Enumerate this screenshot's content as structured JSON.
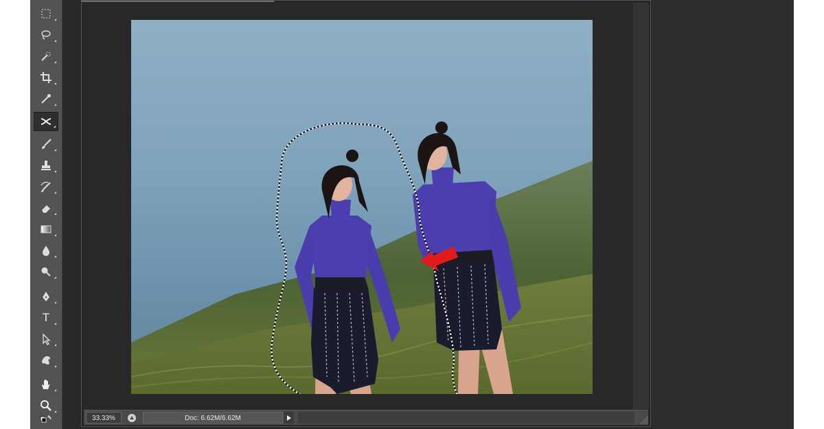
{
  "toolbar": {
    "active_tool": "patch-tool",
    "tools": [
      {
        "name": "marquee-tool-icon"
      },
      {
        "name": "lasso-tool-icon"
      },
      {
        "name": "quick-selection-tool-icon"
      },
      {
        "name": "crop-tool-icon"
      },
      {
        "name": "eyedropper-tool-icon"
      },
      {
        "name": "patch-tool-icon"
      },
      {
        "name": "brush-tool-icon"
      },
      {
        "name": "clone-stamp-tool-icon"
      },
      {
        "name": "history-brush-tool-icon"
      },
      {
        "name": "eraser-tool-icon"
      },
      {
        "name": "gradient-tool-icon"
      },
      {
        "name": "blur-tool-icon"
      },
      {
        "name": "dodge-tool-icon"
      },
      {
        "name": "pen-tool-icon"
      },
      {
        "name": "type-tool-icon"
      },
      {
        "name": "path-selection-tool-icon"
      },
      {
        "name": "custom-shape-tool-icon"
      },
      {
        "name": "hand-tool-icon"
      },
      {
        "name": "zoom-tool-icon"
      },
      {
        "name": "swap-colors-icon"
      }
    ],
    "type_glyph": "T"
  },
  "status": {
    "zoom": "33.33%",
    "doc_info": "Doc: 6.62M/6.62M"
  },
  "colors": {
    "selection_arrow": "#e11a1a",
    "dress": "#4b3fb0",
    "skirt": "#1a1c2e",
    "grass": "#5f6e34"
  }
}
